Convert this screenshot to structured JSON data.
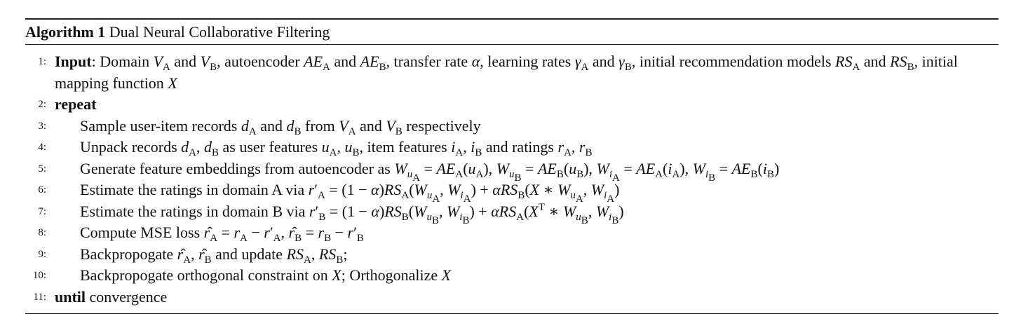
{
  "caption": {
    "label": "Algorithm 1",
    "title": "Dual Neural Collaborative Filtering"
  },
  "lines": [
    {
      "num": "1:",
      "text": "Input: Domain V_A and V_B, autoencoder AE_A and AE_B, transfer rate α, learning rates γ_A and γ_B, initial recommendation models RS_A and RS_B, initial mapping function X"
    },
    {
      "num": "2:",
      "text": "repeat"
    },
    {
      "num": "3:",
      "text": "Sample user-item records d_A and d_B from V_A and V_B respectively"
    },
    {
      "num": "4:",
      "text": "Unpack records d_A, d_B as user features u_A, u_B, item features i_A, i_B and ratings r_A, r_B"
    },
    {
      "num": "5:",
      "text": "Generate feature embeddings from autoencoder as W_{u_A} = AE_A(u_A), W_{u_B} = AE_B(u_B), W_{i_A} = AE_A(i_A), W_{i_B} = AE_B(i_B)"
    },
    {
      "num": "6:",
      "text": "Estimate the ratings in domain A via r'_A = (1 − α)RS_A(W_{u_A}, W_{i_A}) + αRS_B(X ∗ W_{u_A}, W_{i_A})"
    },
    {
      "num": "7:",
      "text": "Estimate the ratings in domain B via r'_B = (1 − α)RS_B(W_{u_B}, W_{i_B}) + αRS_A(X^T ∗ W_{u_B}, W_{i_B})"
    },
    {
      "num": "8:",
      "text": "Compute MSE loss r̂_A = r_A − r'_A, r̂_B = r_B − r'_B"
    },
    {
      "num": "9:",
      "text": "Backpropogate r̂_A, r̂_B and update RS_A, RS_B;"
    },
    {
      "num": "10:",
      "text": "Backpropogate orthogonal constraint on X; Orthogonalize X"
    },
    {
      "num": "11:",
      "text": "until convergence"
    }
  ]
}
